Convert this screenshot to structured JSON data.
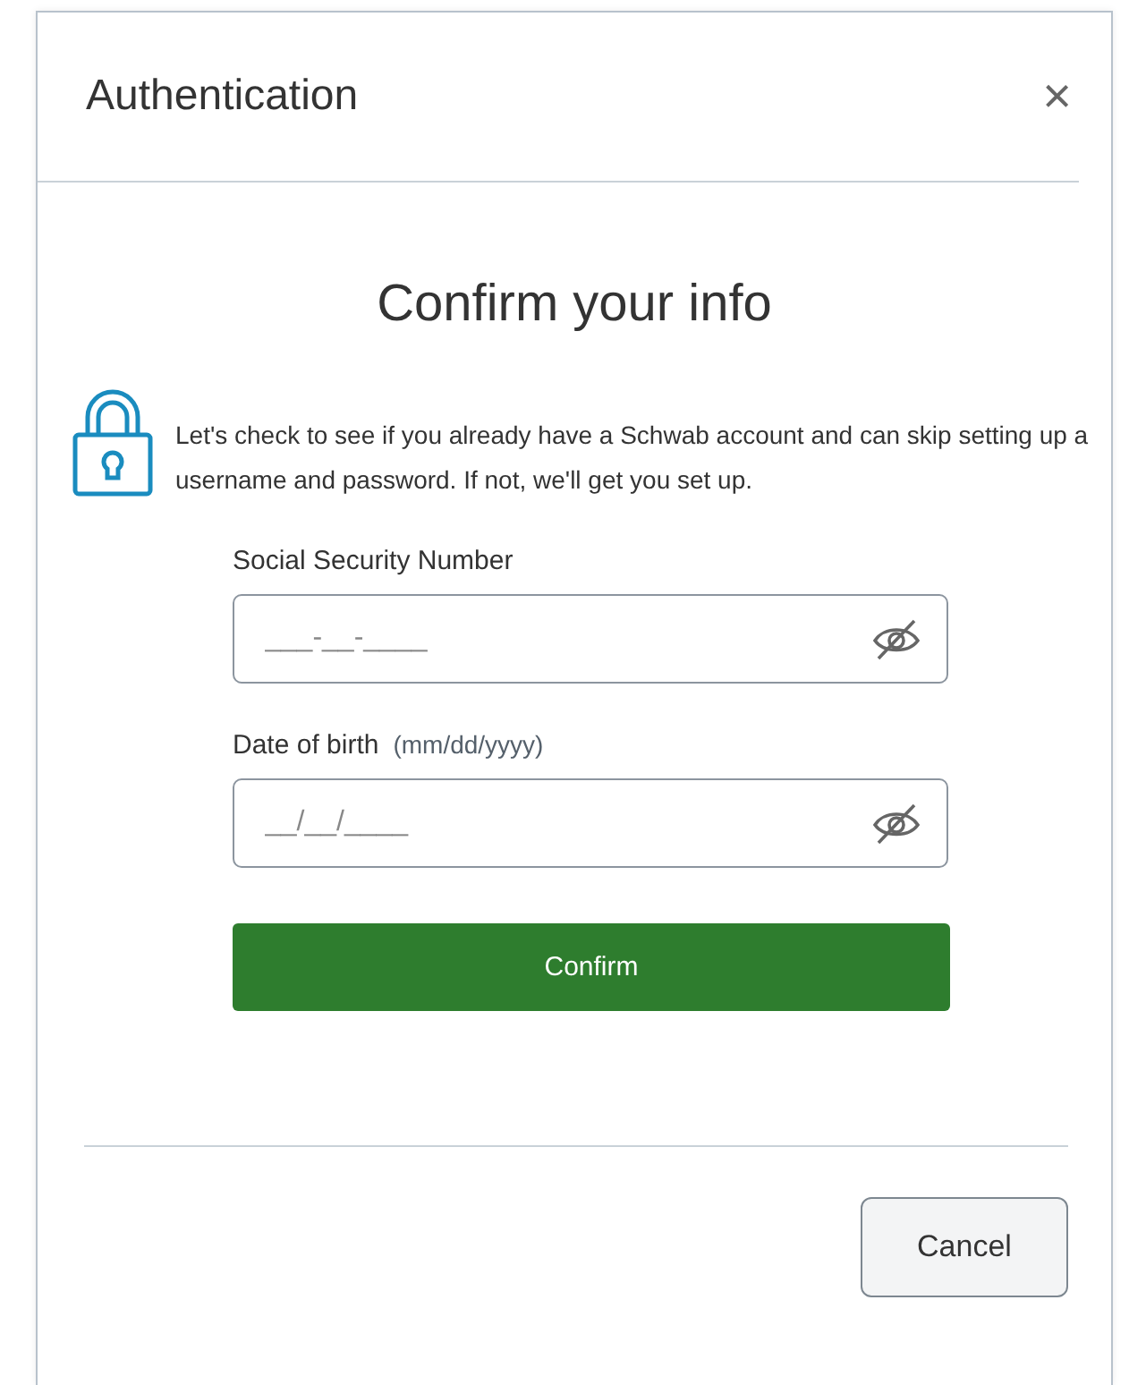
{
  "dialog": {
    "title": "Authentication",
    "close": "×"
  },
  "heading": "Confirm your info",
  "message": "Let's check to see if you already have a Schwab account and can skip setting up a username and password. If not, we'll get you set up.",
  "fields": [
    {
      "label": "Social Security Number",
      "placeholder": "___-__-____"
    },
    {
      "label": "Date of birth",
      "hint": "(mm/dd/yyyy)",
      "placeholder": "__/__/____"
    }
  ],
  "confirm_button": "Confirm",
  "cancel_button": "Cancel"
}
